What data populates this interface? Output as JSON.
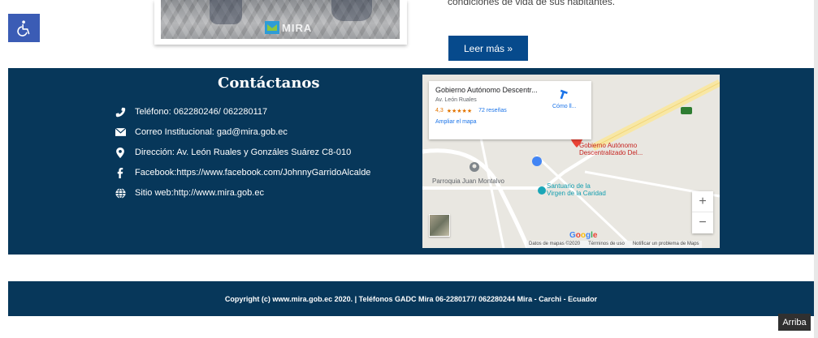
{
  "accessibility": {
    "icon": "wheelchair-icon"
  },
  "news": {
    "image_logo_text": "MIRA",
    "excerpt": "condiciones de vida de sus habitantes.",
    "read_more": "Leer más »"
  },
  "contact": {
    "title": "Contáctanos",
    "items": [
      {
        "icon": "phone-icon",
        "text": "Teléfono: 062280246/ 062280117"
      },
      {
        "icon": "envelope-icon",
        "text": "Correo Institucional: gad@mira.gob.ec"
      },
      {
        "icon": "map-marker-icon",
        "text": "Dirección: Av. León Ruales y Gonzáles Suárez C8-010"
      },
      {
        "icon": "facebook-icon",
        "text": "Facebook:https://www.facebook.com/JohnnyGarridoAlcalde"
      },
      {
        "icon": "globe-icon",
        "text": "Sitio web:http://www.mira.gob.ec"
      }
    ]
  },
  "map": {
    "card": {
      "name": "Gobierno Autónomo Descentr...",
      "address": "Av. León Ruales",
      "rating": "4,3",
      "stars": "★★★★★",
      "reviews": "72 reseñas",
      "enlarge": "Ampliar el mapa",
      "directions": "Cómo ll..."
    },
    "labels": {
      "place_main_1": "Gobierno Autónomo",
      "place_main_2": "Descentralizado Del...",
      "parish": "Parroquia Juan Montalvo",
      "sanctuary_1": "Santuario de la",
      "sanctuary_2": "Virgen de la Caridad",
      "road_shield": "182"
    },
    "zoom_in": "+",
    "zoom_out": "−",
    "footer": {
      "data": "Datos de mapas ©2020",
      "terms": "Términos de uso",
      "report": "Notificar un problema de Maps"
    }
  },
  "footer": {
    "copyright": "Copyright (c) www.mira.gob.ec 2020. | Teléfonos GADC Mira 06-2280177/ 062280244 Mira - Carchi - Ecuador"
  },
  "back_to_top": "Arriba"
}
